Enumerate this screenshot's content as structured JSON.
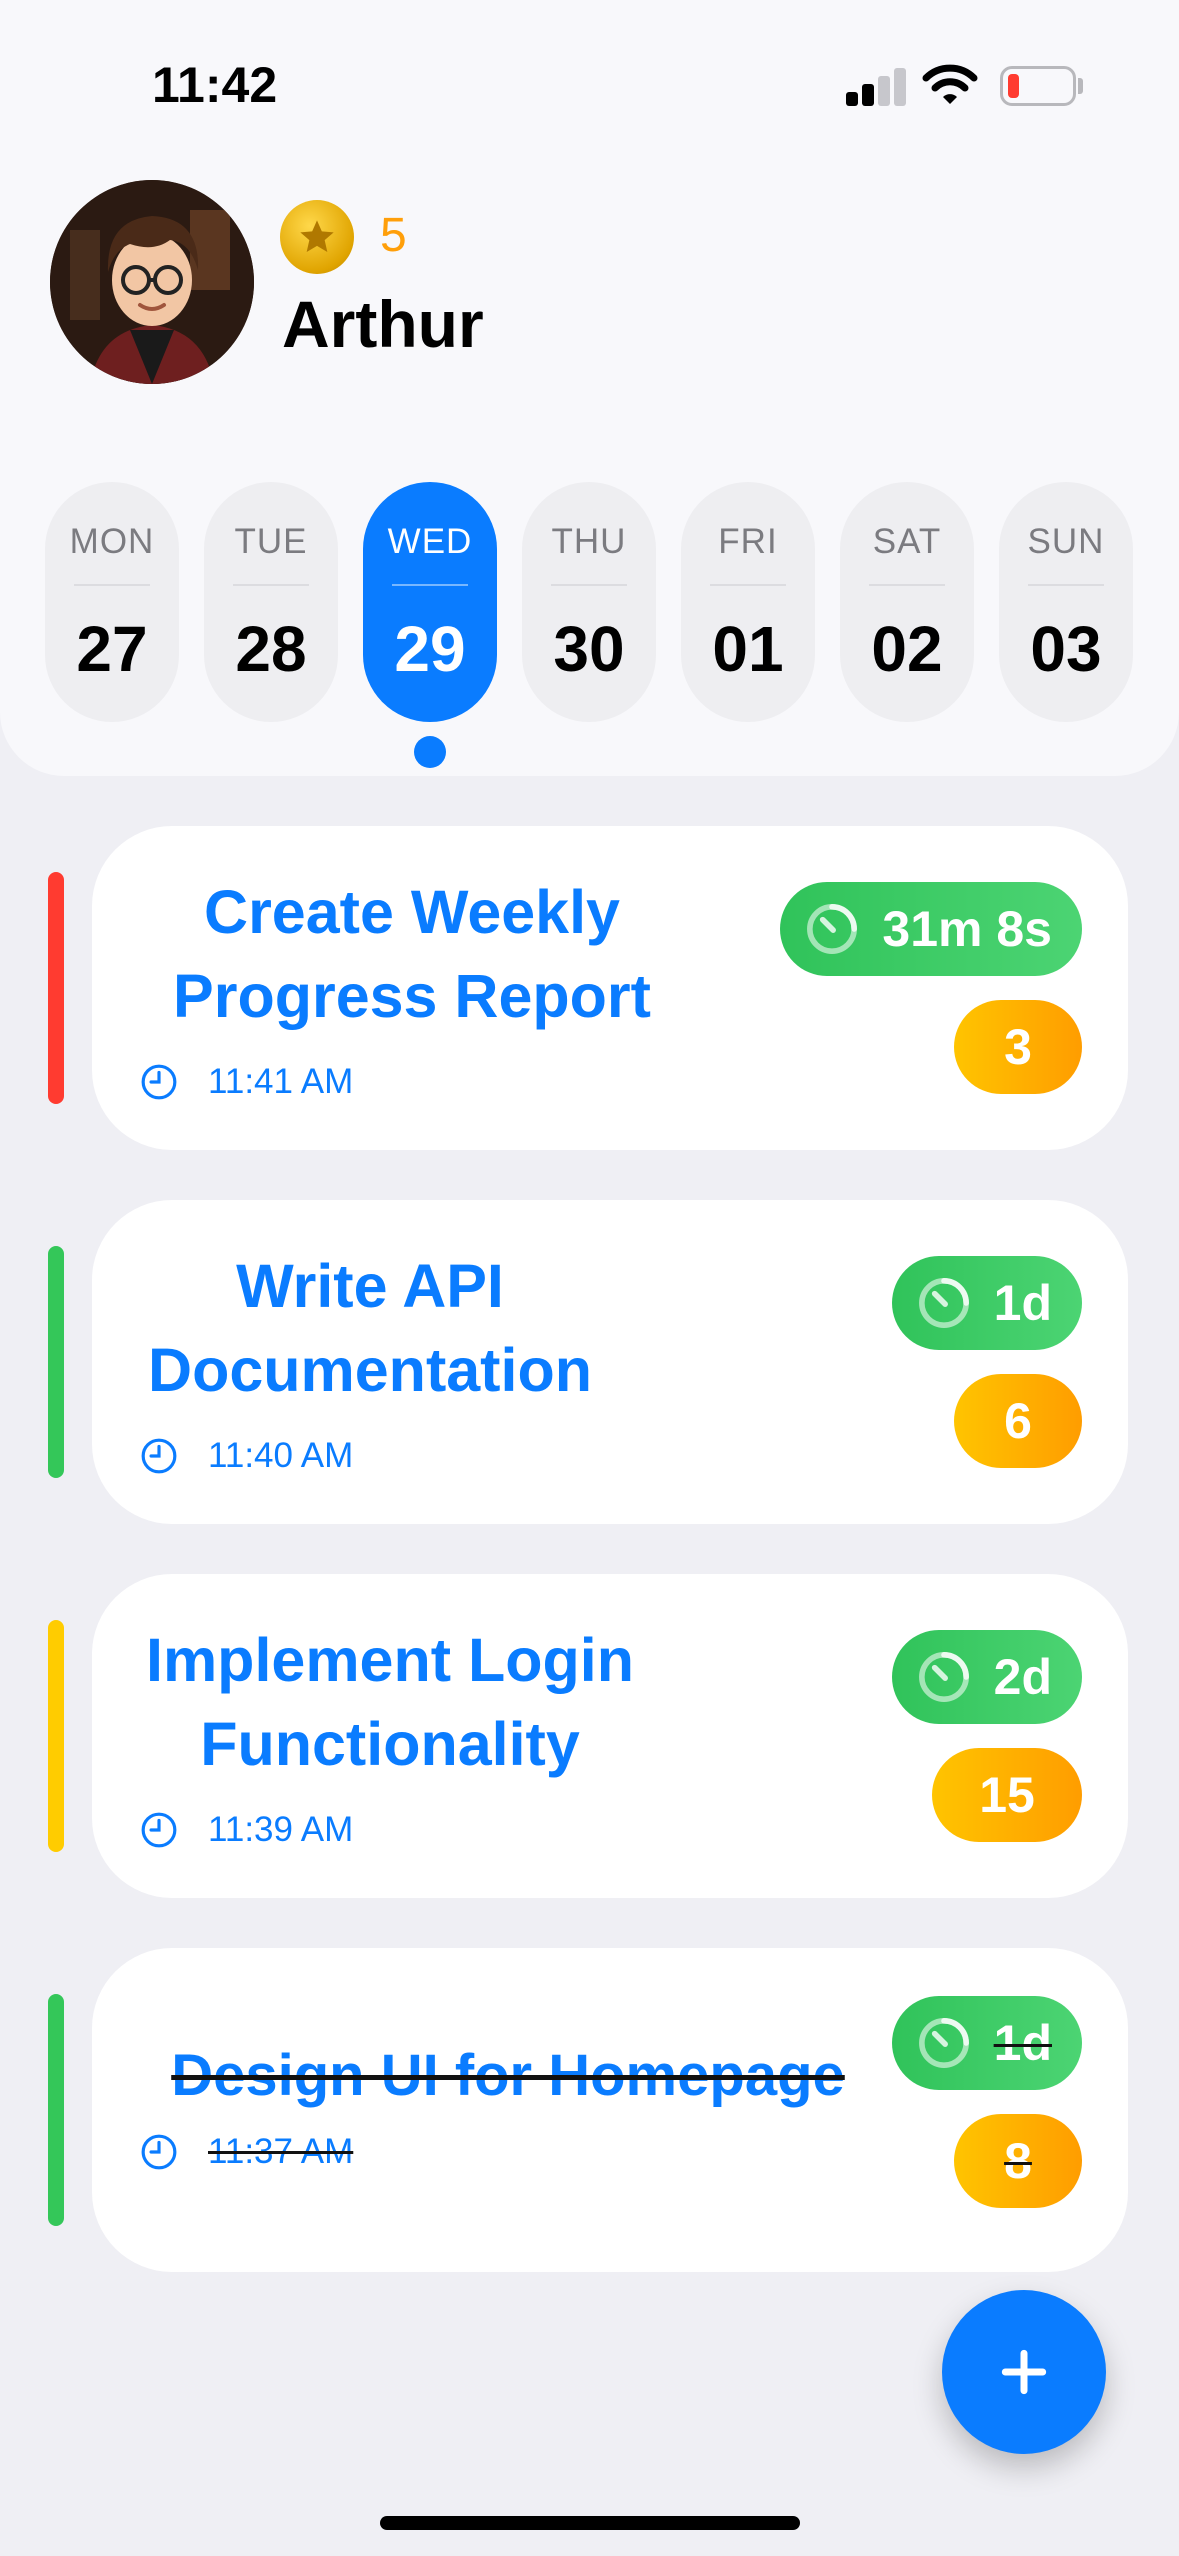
{
  "status_bar": {
    "time": "11:42"
  },
  "profile": {
    "name": "Arthur",
    "coins": "5"
  },
  "week": [
    {
      "name": "MON",
      "num": "27"
    },
    {
      "name": "TUE",
      "num": "28"
    },
    {
      "name": "WED",
      "num": "29"
    },
    {
      "name": "THU",
      "num": "30"
    },
    {
      "name": "FRI",
      "num": "01"
    },
    {
      "name": "SAT",
      "num": "02"
    },
    {
      "name": "SUN",
      "num": "03"
    }
  ],
  "selected_day": "WED",
  "tasks": [
    {
      "title_line1": "Create Weekly",
      "title_line2": "Progress Report",
      "time": "11:41 AM",
      "timer": "31m 8s",
      "points": "3",
      "priority_color": "#ff3b30",
      "completed": false
    },
    {
      "title_line1": "Write API",
      "title_line2": "Documentation",
      "time": "11:40 AM",
      "timer": "1d",
      "points": "6",
      "priority_color": "#34c759",
      "completed": false
    },
    {
      "title_line1": "Implement Login",
      "title_line2": "Functionality",
      "time": "11:39 AM",
      "timer": "2d",
      "points": "15",
      "priority_color": "#ffcc00",
      "completed": false
    },
    {
      "title_line1": "Design UI for Homepage",
      "time": "11:37 AM",
      "timer": "1d",
      "points": "8",
      "priority_color": "#34c759",
      "completed": true
    }
  ],
  "colors": {
    "accent": "#0a7cff",
    "coin": "#ff9f0a",
    "timer": "#34c759",
    "points": "#ff9f0a"
  },
  "icons": {
    "add": "plus-icon",
    "timer": "stopwatch-icon",
    "time": "clock-icon",
    "coin": "star-coin-icon"
  }
}
